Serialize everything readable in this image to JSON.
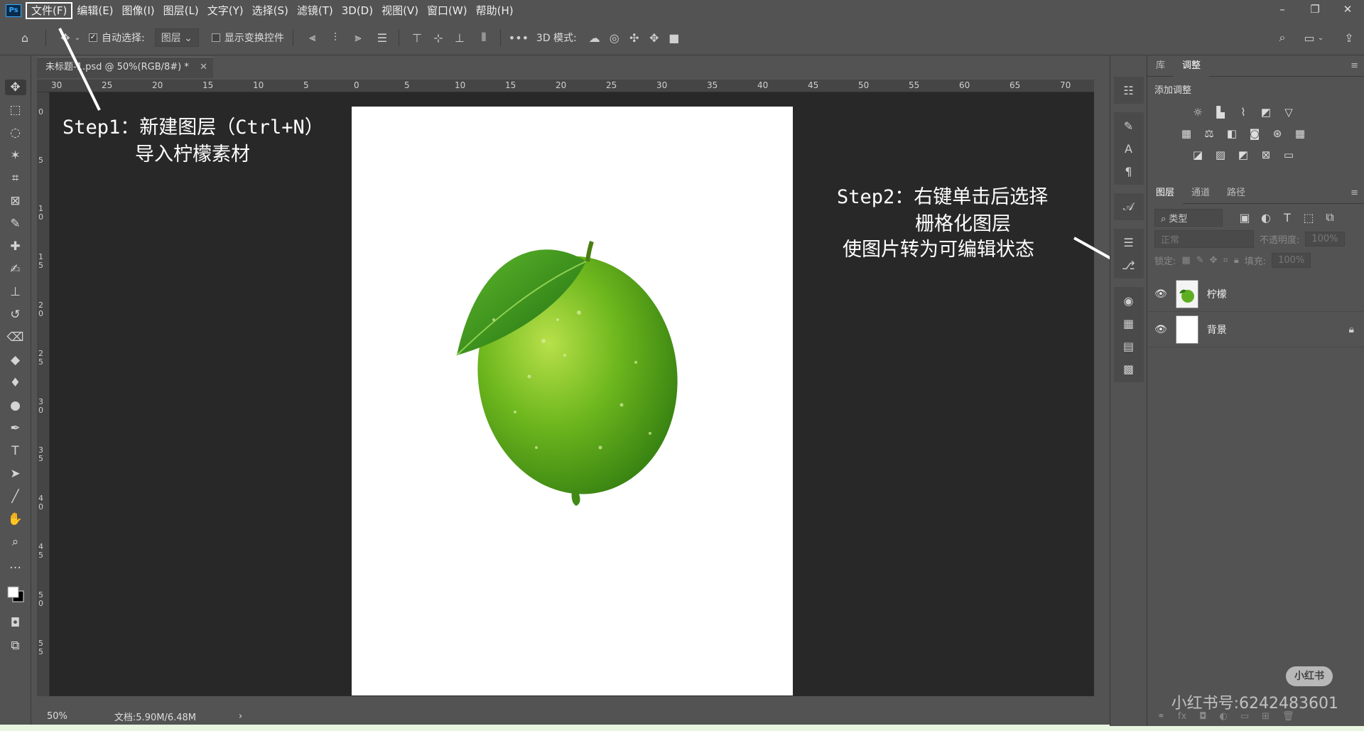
{
  "app": {
    "logo": "Ps"
  },
  "menu": {
    "items": [
      {
        "label": "文件(F)"
      },
      {
        "label": "编辑(E)"
      },
      {
        "label": "图像(I)"
      },
      {
        "label": "图层(L)"
      },
      {
        "label": "文字(Y)"
      },
      {
        "label": "选择(S)"
      },
      {
        "label": "滤镜(T)"
      },
      {
        "label": "3D(D)"
      },
      {
        "label": "视图(V)"
      },
      {
        "label": "窗口(W)"
      },
      {
        "label": "帮助(H)"
      }
    ]
  },
  "options": {
    "auto_select_label": "自动选择:",
    "auto_select_checked": true,
    "auto_select_target": "图层",
    "show_transform_label": "显示变换控件",
    "three_d_mode_label": "3D 模式:"
  },
  "document": {
    "tab_title": "未标题-1.psd @ 50%(RGB/8#) *",
    "zoom": "50%",
    "doc_info": "文档:5.90M/6.48M"
  },
  "rulers": {
    "h_ticks": [
      "30",
      "25",
      "20",
      "15",
      "10",
      "5",
      "0",
      "5",
      "10",
      "15",
      "20",
      "25",
      "30",
      "35",
      "40",
      "45",
      "50",
      "55",
      "60",
      "65",
      "70"
    ],
    "v_ticks": [
      "0",
      "5",
      "1 0",
      "1 5",
      "2 0",
      "2 5",
      "3 0",
      "3 5",
      "4 0",
      "4 5",
      "5 0",
      "5 5"
    ]
  },
  "right_panel": {
    "top_tabs": [
      "库",
      "调整"
    ],
    "adjust_title": "添加调整",
    "layer_tabs": [
      "图层",
      "通道",
      "路径"
    ],
    "filter_kind": "类型",
    "blend_mode": "正常",
    "opacity_label": "不透明度:",
    "opacity_value": "100%",
    "lock_label": "锁定:",
    "fill_label": "填充:",
    "fill_value": "100%",
    "layers": [
      {
        "name": "柠檬",
        "locked": false
      },
      {
        "name": "背景",
        "locked": true
      }
    ]
  },
  "annotations": {
    "step1_line1": "Step1：新建图层（Ctrl+N）",
    "step1_line2": "导入柠檬素材",
    "step2_line1": "Step2：右键单击后选择",
    "step2_line2": "栅格化图层",
    "step2_line3": "使图片转为可编辑状态"
  },
  "watermark": {
    "logo_text": "小红书",
    "text": "小红书号:6242483601"
  }
}
